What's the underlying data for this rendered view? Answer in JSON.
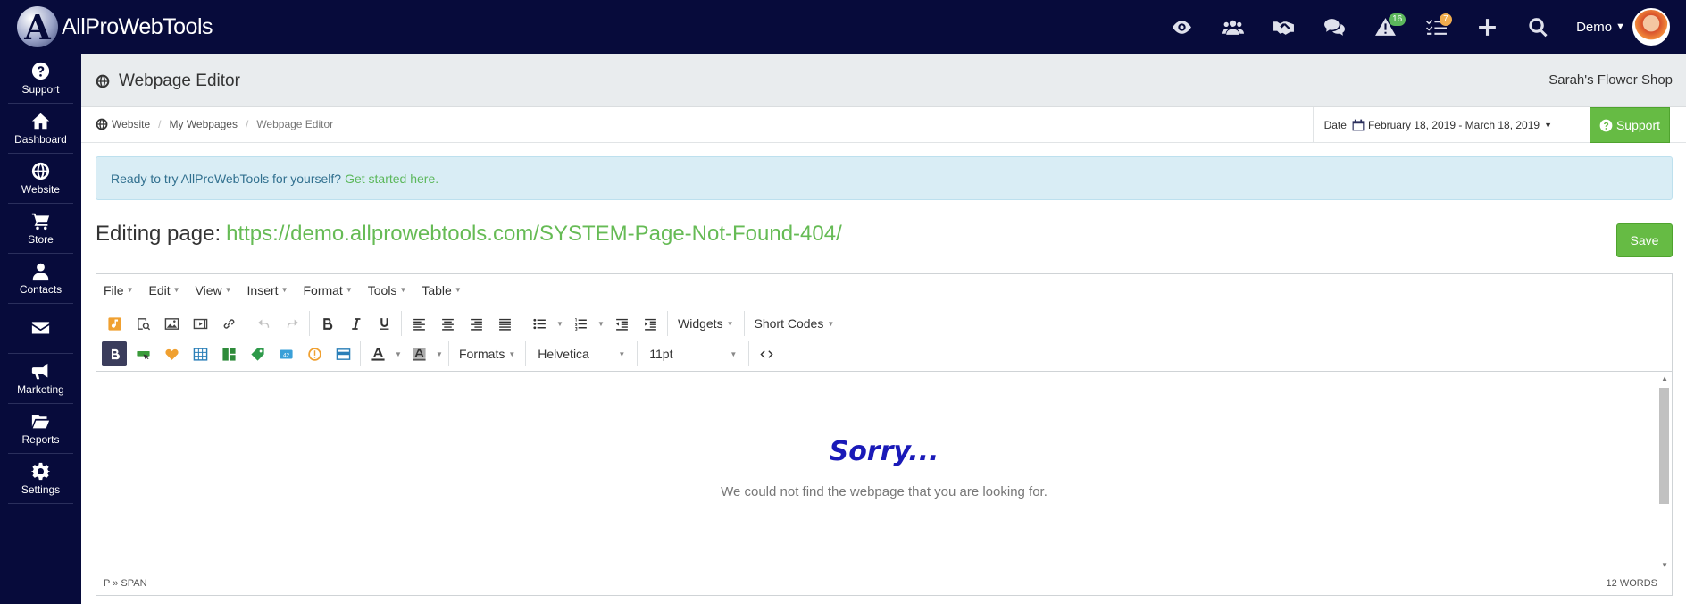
{
  "app": {
    "logo_letter": "A",
    "logo_text": "AllProWebTools"
  },
  "topbar": {
    "notifications_count": "16",
    "tasks_count": "7",
    "user_name": "Demo"
  },
  "sidebar": {
    "items": [
      {
        "label": "Support",
        "icon": "question-circle-icon"
      },
      {
        "label": "Dashboard",
        "icon": "home-icon"
      },
      {
        "label": "Website",
        "icon": "globe-icon"
      },
      {
        "label": "Store",
        "icon": "cart-icon"
      },
      {
        "label": "Contacts",
        "icon": "user-icon"
      },
      {
        "label": "",
        "icon": "envelope-icon"
      },
      {
        "label": "Marketing",
        "icon": "bullhorn-icon"
      },
      {
        "label": "Reports",
        "icon": "folder-open-icon"
      },
      {
        "label": "Settings",
        "icon": "gear-icon"
      }
    ]
  },
  "header": {
    "title": "Webpage Editor",
    "shop_name": "Sarah's Flower Shop"
  },
  "breadcrumb": {
    "items": [
      "Website",
      "My Webpages",
      "Webpage Editor"
    ]
  },
  "date_range": {
    "label": "Date",
    "value": "February 18, 2019 - March 18, 2019"
  },
  "support_button": "Support",
  "alert": {
    "text": "Ready to try AllProWebTools for yourself?",
    "link": "Get started here."
  },
  "editing": {
    "prefix": "Editing page:",
    "url": "https://demo.allprowebtools.com/SYSTEM-Page-Not-Found-404/"
  },
  "save_button": "Save",
  "editor": {
    "menus": [
      "File",
      "Edit",
      "View",
      "Insert",
      "Format",
      "Tools",
      "Table"
    ],
    "widgets_label": "Widgets",
    "shortcodes_label": "Short Codes",
    "formats_label": "Formats",
    "font_family": "Helvetica",
    "font_size": "11pt",
    "heading": "Sorry...",
    "message": "We could not find the webpage that you are looking for.",
    "status_path": "P » SPAN",
    "word_count": "12 WORDS",
    "badge_42": "42"
  },
  "colors": {
    "navy": "#070b3b",
    "green": "#66bb44",
    "sorry_blue": "#1a1ab8",
    "alert_bg": "#d9edf5"
  }
}
